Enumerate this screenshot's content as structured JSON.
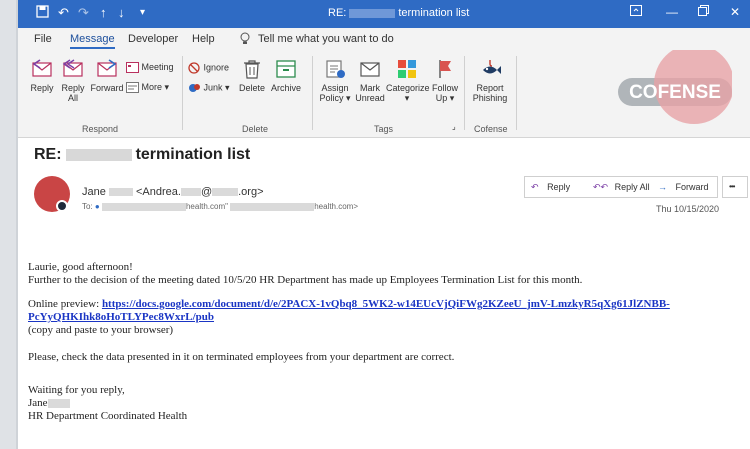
{
  "titlebar": {
    "title_prefix": "RE:",
    "title_suffix": "termination list",
    "icons": [
      "save-icon",
      "undo-icon",
      "redo-icon",
      "up-arrow-icon",
      "down-arrow-icon",
      "customize-icon"
    ]
  },
  "menu": {
    "items": [
      "File",
      "Message",
      "Developer",
      "Help"
    ],
    "tell_me": "Tell me what you want to do"
  },
  "ribbon": {
    "respond": {
      "label": "Respond",
      "reply": "Reply",
      "reply_all_1": "Reply",
      "reply_all_2": "All",
      "forward": "Forward",
      "meeting": "Meeting",
      "more": "More"
    },
    "delete": {
      "label": "Delete",
      "ignore": "Ignore",
      "junk": "Junk",
      "delete": "Delete",
      "archive": "Archive"
    },
    "tags": {
      "label": "Tags",
      "assign_1": "Assign",
      "assign_2": "Policy",
      "unread_1": "Mark",
      "unread_2": "Unread",
      "categorize": "Categorize",
      "follow_1": "Follow",
      "follow_2": "Up"
    },
    "cofense": {
      "label": "Cofense",
      "report_1": "Report",
      "report_2": "Phishing",
      "logo_text": "COFENSE"
    }
  },
  "message": {
    "subject_prefix": "RE:",
    "subject_suffix": "termination list",
    "sender_name": "Jane",
    "sender_email_prefix": "<Andrea.",
    "sender_email_at": "@",
    "sender_email_suffix": ".org>",
    "to_label": "To:",
    "to_addr_1": "health.com\"",
    "to_addr_2": "health.com>",
    "reply": "Reply",
    "reply_all": "Reply All",
    "forward": "Forward",
    "more": "•••",
    "date": "Thu 10/15/2020"
  },
  "body": {
    "greeting": "Laurie, good afternoon!",
    "line1": "Further to the decision of the meeting dated 10/5/20 HR Department has made up Employees Termination List for this month.",
    "preview_label": "Online preview:",
    "link_line1": "https://docs.google.com/document/d/e/2PACX-1vQbq8_5WK2-w14EUcVjQiFWg2KZeeU_jmV-LmzkyR5qXg61JlZNBB-",
    "link_line2": "PcYyQHKIhk8oHoTLYPec8WxrL/pub",
    "copy_note": "(copy and paste to your browser)",
    "check_line": "Please, check the data presented in it on terminated employees from your department are correct.",
    "waiting": "Waiting for you reply,",
    "sig_name": "Jane",
    "sig_org": "HR Department Coordinated Health"
  },
  "colors": {
    "titlebar": "#2f6bc4",
    "link": "#1a35c4",
    "avatar": "#c94545",
    "cofense_badge": "#e7a3a6"
  }
}
